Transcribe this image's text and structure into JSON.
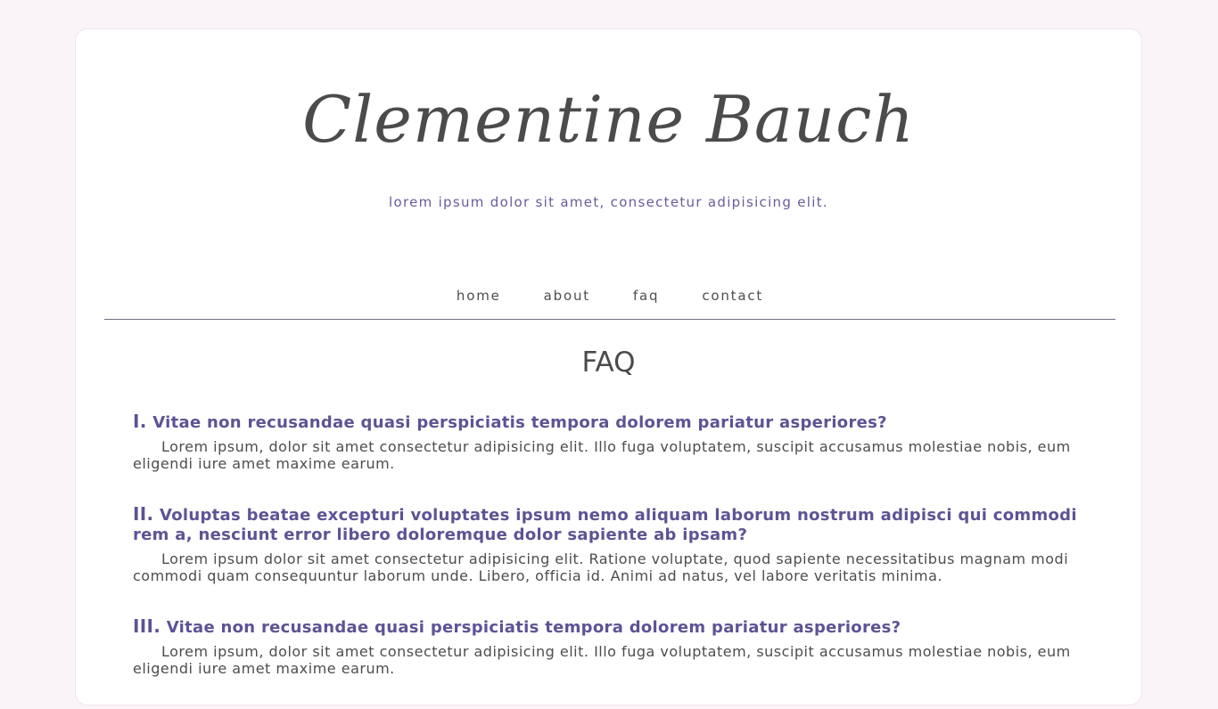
{
  "site": {
    "title": "Clementine Bauch",
    "tagline": "lorem ipsum dolor sit amet, consectetur adipisicing elit."
  },
  "nav": {
    "items": [
      {
        "label": "home"
      },
      {
        "label": "about"
      },
      {
        "label": "faq"
      },
      {
        "label": "contact"
      }
    ]
  },
  "faq": {
    "title": "FAQ",
    "items": [
      {
        "number": "I.",
        "question": "Vitae non recusandae quasi perspiciatis tempora dolorem pariatur asperiores?",
        "answer": "Lorem ipsum, dolor sit amet consectetur adipisicing elit. Illo fuga voluptatem, suscipit accusamus molestiae nobis, eum eligendi iure amet maxime earum."
      },
      {
        "number": "II.",
        "question": "Voluptas beatae excepturi voluptates ipsum nemo aliquam laborum nostrum adipisci qui commodi rem a, nesciunt error libero doloremque dolor sapiente ab ipsam?",
        "answer": "Lorem ipsum dolor sit amet consectetur adipisicing elit. Ratione voluptate, quod sapiente necessitatibus magnam modi commodi quam consequuntur laborum unde. Libero, officia id. Animi ad natus, vel labore veritatis minima."
      },
      {
        "number": "III.",
        "question": "Vitae non recusandae quasi perspiciatis tempora dolorem pariatur asperiores?",
        "answer": "Lorem ipsum, dolor sit amet consectetur adipisicing elit. Illo fuga voluptatem, suscipit accusamus molestiae nobis, eum eligendi iure amet maxime earum."
      }
    ]
  },
  "colors": {
    "background": "#faf4f8",
    "card": "#ffffff",
    "accent": "#5e5394",
    "text": "#4d4d4d"
  }
}
